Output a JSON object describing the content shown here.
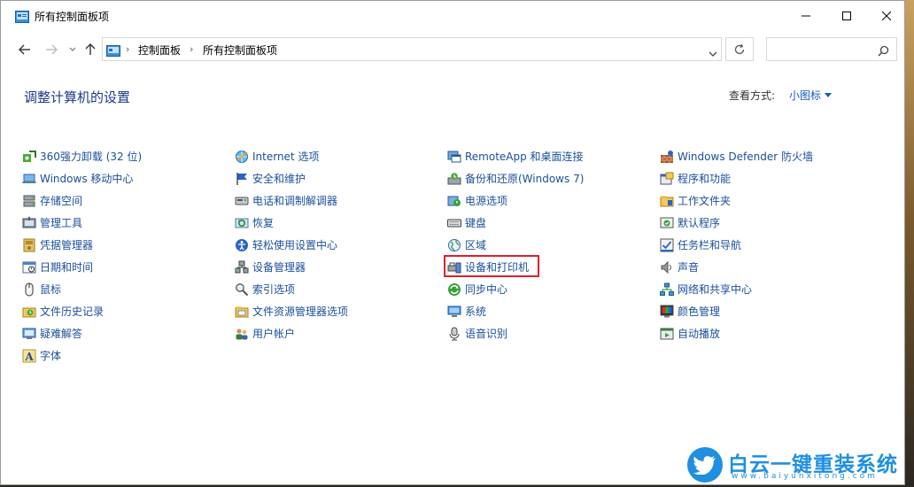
{
  "window": {
    "title": "所有控制面板项"
  },
  "address": {
    "crumbs": [
      "控制面板",
      "所有控制面板项"
    ],
    "search_placeholder": ""
  },
  "main": {
    "heading": "调整计算机的设置",
    "view_by_label": "查看方式:",
    "view_by_value": "小图标"
  },
  "columns": [
    [
      "360强力卸载 (32 位)",
      "Windows 移动中心",
      "存储空间",
      "管理工具",
      "凭据管理器",
      "日期和时间",
      "鼠标",
      "文件历史记录",
      "疑难解答",
      "字体"
    ],
    [
      "Internet 选项",
      "安全和维护",
      "电话和调制解调器",
      "恢复",
      "轻松使用设置中心",
      "设备管理器",
      "索引选项",
      "文件资源管理器选项",
      "用户帐户"
    ],
    [
      "RemoteApp 和桌面连接",
      "备份和还原(Windows 7)",
      "电源选项",
      "键盘",
      "区域",
      "设备和打印机",
      "同步中心",
      "系统",
      "语音识别"
    ],
    [
      "Windows Defender 防火墙",
      "程序和功能",
      "工作文件夹",
      "默认程序",
      "任务栏和导航",
      "声音",
      "网络和共享中心",
      "颜色管理",
      "自动播放"
    ]
  ],
  "icons": [
    [
      "uninstaller-icon",
      "mobility-center-icon",
      "storage-spaces-icon",
      "admin-tools-icon",
      "credential-manager-icon",
      "date-time-icon",
      "mouse-icon",
      "file-history-icon",
      "troubleshooting-icon",
      "fonts-icon"
    ],
    [
      "internet-options-icon",
      "security-flag-icon",
      "phone-modem-icon",
      "recovery-icon",
      "ease-of-access-icon",
      "device-manager-icon",
      "indexing-icon",
      "folder-options-icon",
      "user-accounts-icon"
    ],
    [
      "remoteapp-icon",
      "backup-restore-icon",
      "power-options-icon",
      "keyboard-icon",
      "region-icon",
      "devices-printers-icon",
      "sync-center-icon",
      "system-icon",
      "speech-recognition-icon"
    ],
    [
      "firewall-icon",
      "programs-features-icon",
      "work-folders-icon",
      "default-programs-icon",
      "taskbar-icon",
      "sound-icon",
      "network-sharing-icon",
      "color-management-icon",
      "autoplay-icon"
    ]
  ],
  "highlighted_item": "设备和打印机",
  "colors": {
    "link": "#1a4f9c",
    "heading": "#1a3a8a",
    "highlight_border": "#e0202a",
    "watermark": "#1f8fe0"
  },
  "watermark": {
    "title": "白云一键重装系统",
    "subtitle": "www.baiyunxitong.com"
  }
}
